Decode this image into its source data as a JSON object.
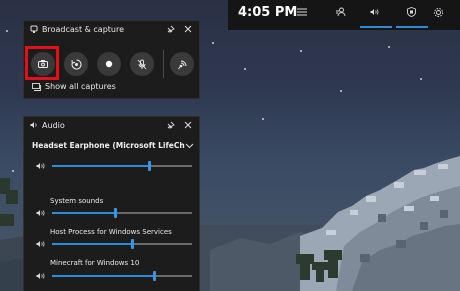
{
  "broadcast": {
    "title": "Broadcast & capture",
    "buttons": [
      "screenshot-icon",
      "record-last-icon",
      "record-icon",
      "mic-off-icon",
      "broadcast-icon"
    ],
    "show_all": "Show all captures"
  },
  "audio": {
    "title": "Audio",
    "device": "Headset Earphone (Microsoft LifeChat L...",
    "master_volume": 0.69,
    "apps": [
      {
        "label": "System sounds",
        "volume": 0.45
      },
      {
        "label": "Host Process for Windows Services",
        "volume": 0.57
      },
      {
        "label": "Minecraft for Windows 10",
        "volume": 0.73
      }
    ]
  },
  "topbar": {
    "time": "4:05 PM",
    "icons": [
      "menu-icon",
      "xbox-social-icon",
      "audio-icon",
      "capture-widget-icon",
      "settings-icon"
    ]
  },
  "colors": {
    "accent": "#2e8bd8",
    "highlight": "#e3101c",
    "panel": "#1c1c1c"
  }
}
